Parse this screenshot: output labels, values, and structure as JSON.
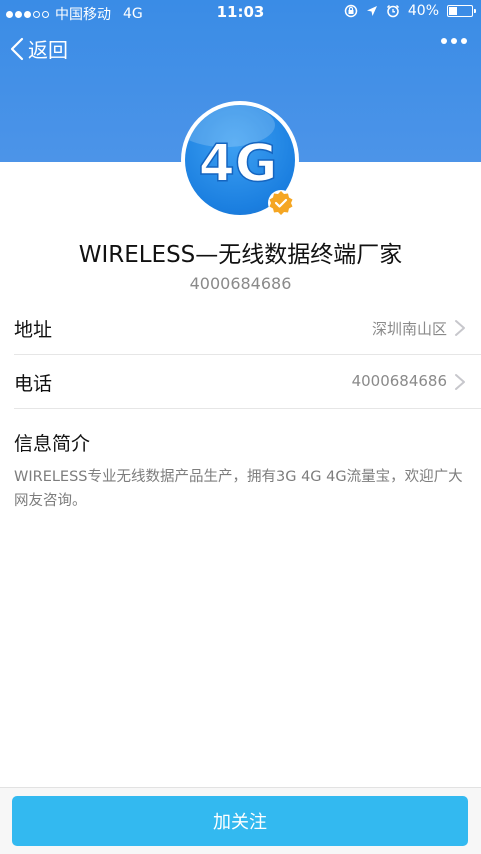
{
  "status_bar": {
    "carrier": "中国移动",
    "network": "4G",
    "time": "11:03",
    "battery_percent": "40%",
    "battery_level": 0.4,
    "signal_bars_filled": 3,
    "signal_bars_total": 5
  },
  "nav": {
    "back_label": "返回"
  },
  "profile": {
    "avatar_text": "4G",
    "name": "WIRELESS—无线数据终端厂家",
    "id": "4000684686"
  },
  "rows": [
    {
      "label": "地址",
      "value": "深圳南山区"
    },
    {
      "label": "电话",
      "value": "4000684686"
    }
  ],
  "intro": {
    "title": "信息简介",
    "text": "WIRELESS专业无线数据产品生产，拥有3G 4G 4G流量宝，欢迎广大网友咨询。"
  },
  "footer": {
    "follow_label": "加关注"
  },
  "colors": {
    "header": "#3a8ce6",
    "button": "#33b9f0",
    "badge": "#f5a623"
  }
}
